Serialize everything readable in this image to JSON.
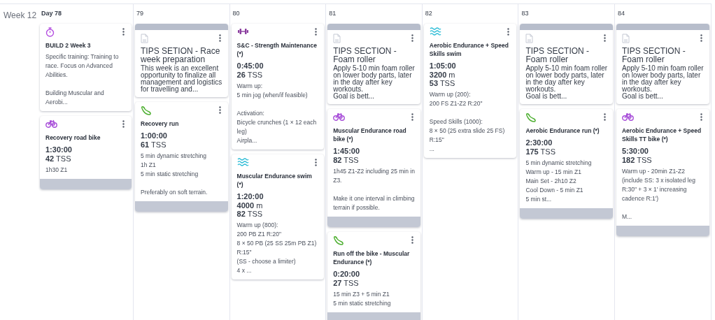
{
  "week_label": "Week 12",
  "days": [
    {
      "label": "Day 78",
      "cards": [
        {
          "kind": "phase",
          "title": "BUILD 2 Week 3",
          "paragraphs": [
            "Specific training: Training to race. Focus on Advanced Abilities.",
            "Building Muscular and Aerobi..."
          ]
        },
        {
          "kind": "bike",
          "title": "Recovery road bike",
          "duration": "1:30:00",
          "tss": {
            "value": "42",
            "unit": "TSS"
          },
          "paragraphs": [
            "1h30 Z1"
          ],
          "footer_bar": true
        }
      ]
    },
    {
      "label": "79",
      "cards": [
        {
          "kind": "note",
          "title": "TIPS SETION - Race week preparation",
          "paragraphs": [
            "This week is an excellent opportunity to finalize all management and logistics for travelling and..."
          ]
        },
        {
          "kind": "run",
          "title": "Recovery run",
          "duration": "1:00:00",
          "tss": {
            "value": "61",
            "unit": "TSS"
          },
          "paragraphs": [
            "5 min dynamic stretching\n1h Z1\n5 min static stretching",
            "Preferably on soft terrain."
          ],
          "footer_bar": true
        }
      ]
    },
    {
      "label": "80",
      "cards": [
        {
          "kind": "strength",
          "title": "S&C - Strength Maintenance (*)",
          "duration": "0:45:00",
          "tss": {
            "value": "26",
            "unit": "TSS"
          },
          "paragraphs": [
            "Warm up:\n5 min jog (when/if feasible)",
            "Activation:\nBicycle crunches (1 × 12 each leg)\nAirpla..."
          ],
          "footer_bar": false
        },
        {
          "kind": "swim",
          "title": "Muscular Endurance swim (*)",
          "duration": "1:20:00",
          "distance": {
            "value": "4000",
            "unit": "m"
          },
          "tss": {
            "value": "82",
            "unit": "TSS"
          },
          "paragraphs": [
            "Warm up (800):\n200 PB Z1 R:20\"\n8 × 50 PB (25 SS 25m PB Z1) R:15\"\n(SS - choose a limiter)\n4 x ..."
          ],
          "footer_bar": false
        }
      ]
    },
    {
      "label": "81",
      "cards": [
        {
          "kind": "note",
          "title": "TIPS SECTION - Foam roller",
          "paragraphs": [
            "Apply 5-10 min foam roller on lower body parts, later in the day after key workouts.\nGoal is bett..."
          ]
        },
        {
          "kind": "bike",
          "title": "Muscular Endurance road bike (*)",
          "duration": "1:45:00",
          "tss": {
            "value": "82",
            "unit": "TSS"
          },
          "paragraphs": [
            "1h45 Z1-Z2 including 25 min in Z3.",
            "Make it one interval in climbing terrain if possible."
          ],
          "footer_bar": true
        },
        {
          "kind": "run",
          "title": "Run off the bike - Muscular Endurance (*)",
          "duration": "0:20:00",
          "tss": {
            "value": "27",
            "unit": "TSS"
          },
          "paragraphs": [
            "15 min Z3 + 5 min Z1\n5 min static stretching"
          ],
          "footer_bar": true
        }
      ]
    },
    {
      "label": "82",
      "cards": [
        {
          "kind": "swim",
          "title": "Aerobic Endurance + Speed Skills swim",
          "duration": "1:05:00",
          "distance": {
            "value": "3200",
            "unit": "m"
          },
          "tss": {
            "value": "53",
            "unit": "TSS"
          },
          "paragraphs": [
            "Warm up (200):\n200 FS Z1-Z2 R:20\"",
            "Speed Skills (1000):\n8 × 50 (25 extra slide 25 FS) R:15\"\n..."
          ],
          "footer_bar": false
        }
      ]
    },
    {
      "label": "83",
      "cards": [
        {
          "kind": "note",
          "title": "TIPS SECTION - Foam roller",
          "paragraphs": [
            "Apply 5-10 min foam roller on lower body parts, later in the day after key workouts.\nGoal is bett..."
          ]
        },
        {
          "kind": "run",
          "title": "Aerobic Endurance run (*)",
          "duration": "2:30:00",
          "tss": {
            "value": "175",
            "unit": "TSS"
          },
          "paragraphs": [
            "5 min dynamic stretching\nWarm up - 15 min Z1\nMain Set - 2h10 Z2\nCool Down - 5 min Z1\n5 min st..."
          ],
          "footer_bar": true
        }
      ]
    },
    {
      "label": "84",
      "cards": [
        {
          "kind": "note",
          "title": "TIPS SECTION - Foam roller",
          "paragraphs": [
            "Apply 5-10 min foam roller on lower body parts, later in the day after key workouts.\nGoal is bett..."
          ]
        },
        {
          "kind": "bike",
          "title": "Aerobic Endurance + Speed Skills TT bike (*)",
          "duration": "5:30:00",
          "tss": {
            "value": "182",
            "unit": "TSS"
          },
          "paragraphs": [
            "Warm up - 20min Z1-Z2 (include SS: 3 x isolated leg R:30\" + 3 × 1' increasing cadence R:1')",
            "M..."
          ],
          "footer_bar": true
        }
      ]
    }
  ]
}
